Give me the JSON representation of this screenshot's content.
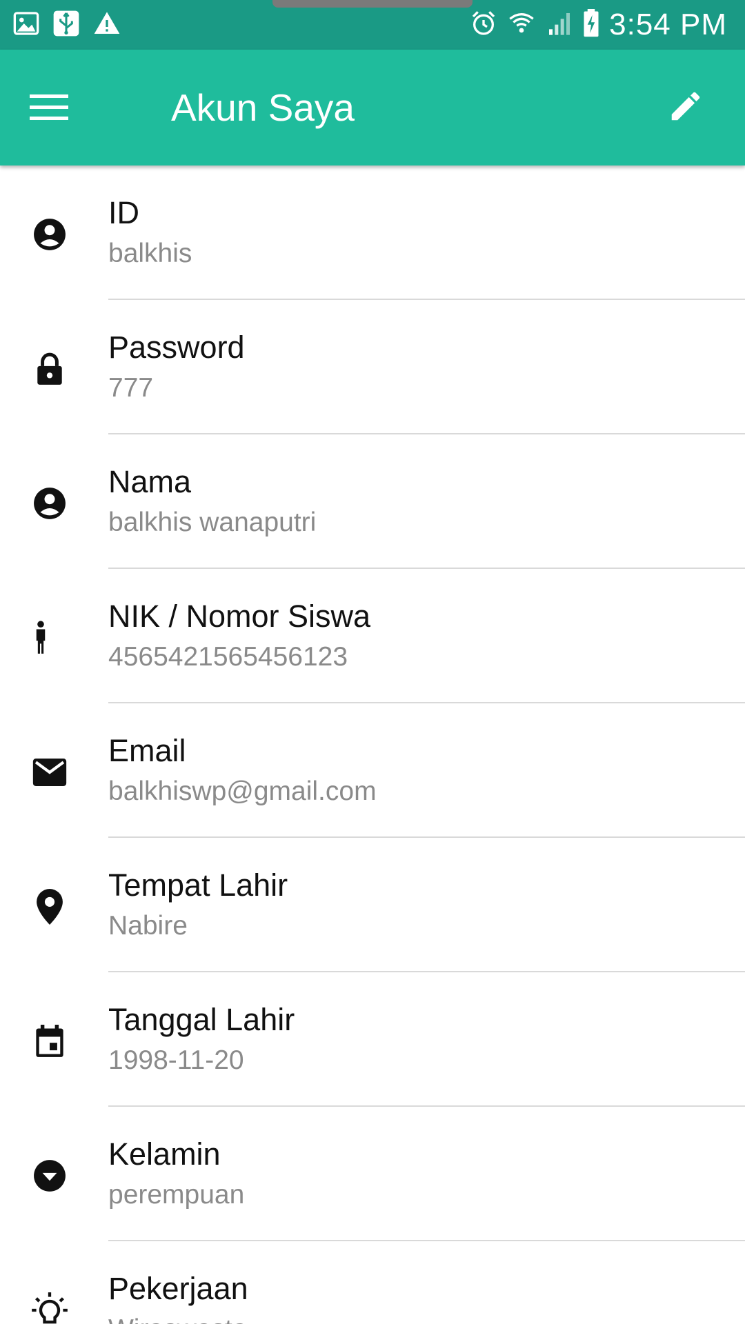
{
  "status_bar": {
    "time": "3:54 PM",
    "left_icons": [
      "image-icon",
      "usb-icon",
      "warning-icon"
    ],
    "right_icons": [
      "alarm-icon",
      "wifi-icon",
      "signal-icon",
      "battery-charging-icon"
    ]
  },
  "app_bar": {
    "title": "Akun Saya",
    "menu_icon": "hamburger-menu-icon",
    "action_icon": "edit-pencil-icon",
    "color": "#1fbc9c"
  },
  "profile_fields": [
    {
      "label": "ID",
      "value": "balkhis",
      "icon": "account-circle-icon"
    },
    {
      "label": "Password",
      "value": "777",
      "icon": "lock-icon"
    },
    {
      "label": "Nama",
      "value": "balkhis wanaputri",
      "icon": "account-circle-icon"
    },
    {
      "label": "NIK / Nomor Siswa",
      "value": "4565421565456123",
      "icon": "person-standing-icon"
    },
    {
      "label": "Email",
      "value": "balkhiswp@gmail.com",
      "icon": "mail-icon"
    },
    {
      "label": "Tempat Lahir",
      "value": "Nabire",
      "icon": "location-pin-icon"
    },
    {
      "label": "Tanggal Lahir",
      "value": "1998-11-20",
      "icon": "calendar-icon"
    },
    {
      "label": "Kelamin",
      "value": "perempuan",
      "icon": "dropdown-circle-icon"
    },
    {
      "label": "Pekerjaan",
      "value": "Wiraswasta",
      "icon": "lightbulb-icon"
    }
  ]
}
